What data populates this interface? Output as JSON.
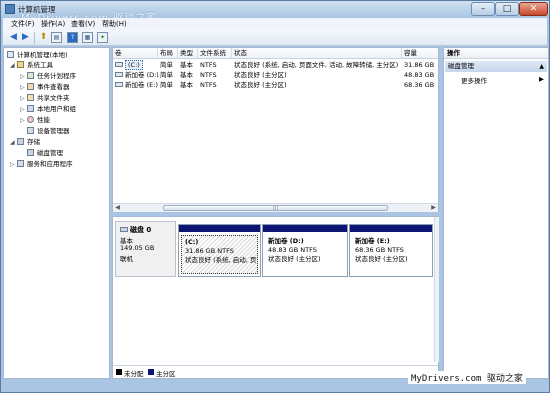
{
  "window": {
    "title": "计算机管理",
    "watermark_top": "MyDrivers.com 驱动之家",
    "controls": {
      "minimize": "–",
      "maximize": "□",
      "close": "✕"
    }
  },
  "menubar": {
    "items": [
      "文件(F)",
      "操作(A)",
      "查看(V)",
      "帮助(H)"
    ]
  },
  "toolbar": {
    "buttons": [
      {
        "icon": "back-arrow-icon",
        "glyph": "◀"
      },
      {
        "icon": "forward-arrow-icon",
        "glyph": "▶"
      },
      {
        "icon": "up-folder-icon",
        "glyph": "⬆"
      },
      {
        "icon": "show-hide-tree-icon",
        "glyph": "▤"
      },
      {
        "icon": "help-icon",
        "glyph": "?"
      },
      {
        "icon": "properties-icon",
        "glyph": "▦"
      },
      {
        "icon": "wizard-icon",
        "glyph": "✦"
      }
    ]
  },
  "tree": {
    "root": "计算机管理(本地)",
    "system_tools": "系统工具",
    "task_scheduler": "任务计划程序",
    "event_viewer": "事件查看器",
    "shared_folders": "共享文件夹",
    "local_users": "本地用户和组",
    "performance": "性能",
    "device_manager": "设备管理器",
    "storage": "存储",
    "disk_management": "磁盘管理",
    "services_apps": "服务和应用程序"
  },
  "volume_table": {
    "headers": [
      "卷",
      "布局",
      "类型",
      "文件系统",
      "状态",
      "容量"
    ],
    "rows": [
      {
        "volume": "(C:)",
        "layout": "简单",
        "type": "基本",
        "fs": "NTFS",
        "status": "状态良好 (系统, 启动, 页面文件, 活动, 故障转储, 主分区)",
        "capacity": "31.86 GB"
      },
      {
        "volume": "新加卷 (D:)",
        "layout": "简单",
        "type": "基本",
        "fs": "NTFS",
        "status": "状态良好 (主分区)",
        "capacity": "48.83 GB"
      },
      {
        "volume": "新加卷 (E:)",
        "layout": "简单",
        "type": "基本",
        "fs": "NTFS",
        "status": "状态良好 (主分区)",
        "capacity": "68.36 GB"
      }
    ]
  },
  "disk_map": {
    "disk": {
      "name": "磁盘 0",
      "type": "基本",
      "size": "149.05 GB",
      "state": "联机"
    },
    "partitions": [
      {
        "name": "(C:)",
        "size": "31.86 GB NTFS",
        "status": "状态良好 (系统, 启动, 页面",
        "selected": true
      },
      {
        "name": "新加卷 (D:)",
        "size": "48.83 GB NTFS",
        "status": "状态良好 (主分区)",
        "selected": false
      },
      {
        "name": "新加卷 (E:)",
        "size": "68.36 GB NTFS",
        "status": "状态良好 (主分区)",
        "selected": false
      }
    ],
    "legend": [
      {
        "label": "未分配",
        "color": "#000000"
      },
      {
        "label": "主分区",
        "color": "#0d1573"
      }
    ]
  },
  "actions": {
    "header": "操作",
    "section": "磁盘管理",
    "more": "更多操作"
  },
  "watermark_bottom": "MyDrivers.com 驱动之家",
  "colors": {
    "accent": "#0d1573",
    "frame": "#a9c5e3"
  }
}
